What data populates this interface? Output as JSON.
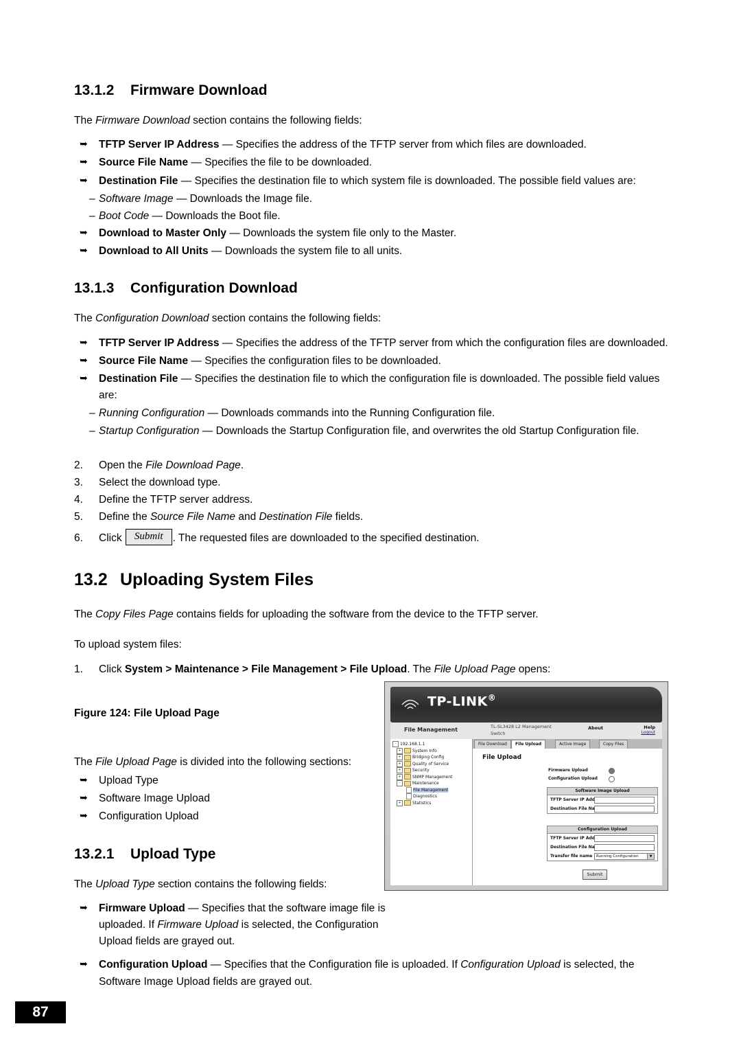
{
  "doc": {
    "page_number": "87",
    "sections": {
      "firmware_download": {
        "number": "13.1.2",
        "title": "Firmware Download",
        "intro_prefix": "The ",
        "intro_italic": "Firmware Download",
        "intro_suffix": " section contains the following fields:",
        "bullets": [
          {
            "bold": "TFTP Server IP Address",
            "rest": " — Specifies the address of the TFTP server from which files are downloaded."
          },
          {
            "bold": "Source File Name",
            "rest": " — Specifies the file to be downloaded."
          },
          {
            "bold": "Destination File",
            "rest": " — Specifies the destination file to which system file is downloaded. The possible field values are:"
          }
        ],
        "sub_items": [
          {
            "italic": "Software Image",
            "rest": " — Downloads the Image file."
          },
          {
            "italic": "Boot Code",
            "rest": " — Downloads the Boot file."
          }
        ],
        "bullets_after": [
          {
            "bold": "Download to Master Only",
            "rest": " — Downloads the system file only to the Master."
          },
          {
            "bold": "Download to All Units",
            "rest": " — Downloads the system file to all units."
          }
        ]
      },
      "configuration_download": {
        "number": "13.1.3",
        "title": "Configuration Download",
        "intro_prefix": "The ",
        "intro_italic": "Configuration Download",
        "intro_suffix": " section contains the following fields:",
        "bullets": [
          {
            "bold": "TFTP Server IP Address",
            "rest": " — Specifies the address of the TFTP server from which the configuration files are downloaded."
          },
          {
            "bold": "Source File Name",
            "rest": " — Specifies the configuration files to be downloaded."
          },
          {
            "bold": "Destination File",
            "rest": " — Specifies the destination file to which the configuration file is downloaded. The possible field values are:"
          }
        ],
        "sub_items": [
          {
            "italic": "Running Configuration",
            "rest": " — Downloads commands into the Running Configuration file."
          },
          {
            "italic": "Startup Configuration",
            "rest": " — Downloads the Startup Configuration file, and overwrites the old Startup Configuration file."
          }
        ],
        "steps": [
          {
            "n": "2.",
            "pre": "Open the ",
            "italic": "File Download Page",
            "post": "."
          },
          {
            "n": "3.",
            "pre": "Select the download type.",
            "italic": "",
            "post": ""
          },
          {
            "n": "4.",
            "pre": "Define the TFTP server address.",
            "italic": "",
            "post": ""
          },
          {
            "n": "5.",
            "pre": "Define the ",
            "italic": "Source File Name",
            "mid": " and ",
            "italic2": "Destination File",
            "post": " fields."
          }
        ],
        "step6": {
          "n": "6.",
          "pre": "Click ",
          "button": "Submit",
          "post": ". The requested files are downloaded to the specified destination."
        }
      },
      "uploading_system_files": {
        "number": "13.2",
        "title": "Uploading System Files",
        "intro_prefix": "The ",
        "intro_italic": "Copy Files Page",
        "intro_suffix": " contains fields for uploading the software from the device to the TFTP server.",
        "to_upload": "To upload system files:",
        "step1": {
          "n": "1.",
          "pre": "Click ",
          "bold": "System > Maintenance > File Management > File Upload",
          "mid": ". The ",
          "italic": "File Upload Page",
          "post": " opens:"
        },
        "figure_caption": "Figure 124: File Upload Page",
        "divided_prefix": "The ",
        "divided_italic": "File Upload Page",
        "divided_suffix": " is divided into the following sections:",
        "divided_items": [
          "Upload Type",
          "Software Image Upload",
          "Configuration Upload"
        ]
      },
      "upload_type": {
        "number": "13.2.1",
        "title": "Upload Type",
        "intro_prefix": "The ",
        "intro_italic": "Upload Type",
        "intro_suffix": " section contains the following fields:",
        "bullet1": {
          "bold": "Firmware Upload",
          "p1": " — Specifies that the software image file is uploaded. If ",
          "i1": "Firmware Upload",
          "p2": " is selected, the Configuration Upload fields are grayed out."
        },
        "bullet2": {
          "bold": "Configuration Upload",
          "p1": " — Specifies that the Configuration file is uploaded. If ",
          "i1": "Configuration Upload",
          "p2": " is selected, the Software Image Upload fields are grayed out."
        }
      }
    }
  },
  "screenshot": {
    "brand": "TP-LINK",
    "brand_dot": "®",
    "section_label": "File Management",
    "model_line1": "TL-SL3428 L2 Management",
    "model_line2": "Switch",
    "about": "About",
    "help": "Help",
    "logout": "Logout",
    "tabs": [
      {
        "label": "File Download",
        "active": false
      },
      {
        "label": "File Upload",
        "active": true
      },
      {
        "label": "Active Image",
        "active": false
      },
      {
        "label": "Copy Files",
        "active": false
      }
    ],
    "tree": [
      {
        "label": "192.168.1.1",
        "depth": 0,
        "type": "root"
      },
      {
        "label": "System Info",
        "depth": 1,
        "type": "folder"
      },
      {
        "label": "Bridging Config",
        "depth": 1,
        "type": "folder"
      },
      {
        "label": "Quality of Service",
        "depth": 1,
        "type": "folder"
      },
      {
        "label": "Security",
        "depth": 1,
        "type": "folder"
      },
      {
        "label": "SNMP Management",
        "depth": 1,
        "type": "folder"
      },
      {
        "label": "Maintenance",
        "depth": 1,
        "type": "folder-open"
      },
      {
        "label": "File Management",
        "depth": 2,
        "type": "leaf-selected"
      },
      {
        "label": "Diagnostics",
        "depth": 2,
        "type": "leaf"
      },
      {
        "label": "Statistics",
        "depth": 1,
        "type": "folder"
      }
    ],
    "page_title": "File Upload",
    "upload_type": [
      {
        "label": "Firmware Upload",
        "selected": true
      },
      {
        "label": "Configuration Upload",
        "selected": false
      }
    ],
    "software_image_upload": {
      "header": "Software Image Upload",
      "fields": [
        {
          "label": "TFTP Server IP Address",
          "value": "",
          "type": "text"
        },
        {
          "label": "Destination File Name",
          "value": "",
          "type": "text"
        }
      ]
    },
    "configuration_upload": {
      "header": "Configuration Upload",
      "fields": [
        {
          "label": "TFTP Server IP Address",
          "value": "",
          "type": "text"
        },
        {
          "label": "Destination File Name",
          "value": "",
          "type": "text"
        },
        {
          "label": "Transfer file name",
          "value": "Running Configuration",
          "type": "select"
        }
      ]
    },
    "submit_label": "Submit"
  }
}
